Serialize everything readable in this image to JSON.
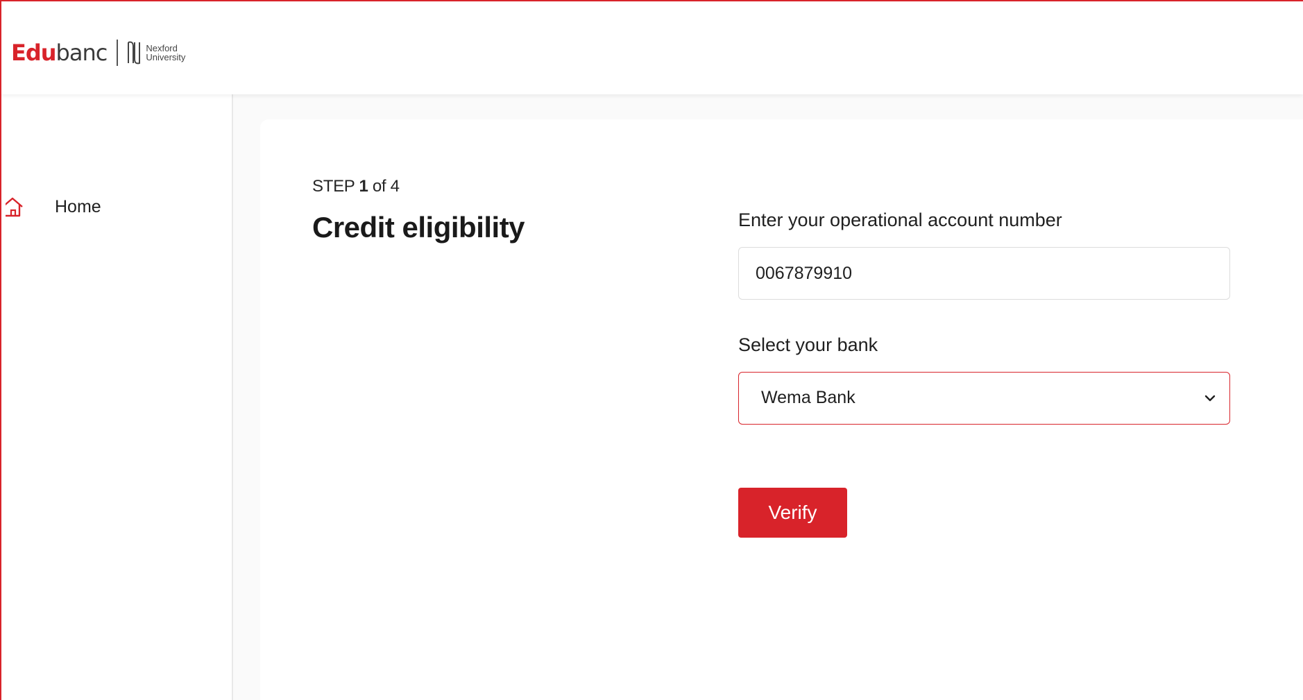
{
  "brand": {
    "name_bold": "Edu",
    "name_regular": "banc",
    "partner_line1": "Nexford",
    "partner_line2": "University",
    "accent_color": "#d8232a"
  },
  "sidebar": {
    "items": [
      {
        "label": "Home",
        "icon": "home-icon"
      }
    ]
  },
  "main": {
    "step_prefix": "STEP",
    "step_current": "1",
    "step_suffix": "of 4",
    "title": "Credit eligibility",
    "account_label": "Enter your operational account number",
    "account_value": "0067879910",
    "bank_label": "Select your bank",
    "bank_selected": "Wema Bank",
    "verify_label": "Verify"
  }
}
